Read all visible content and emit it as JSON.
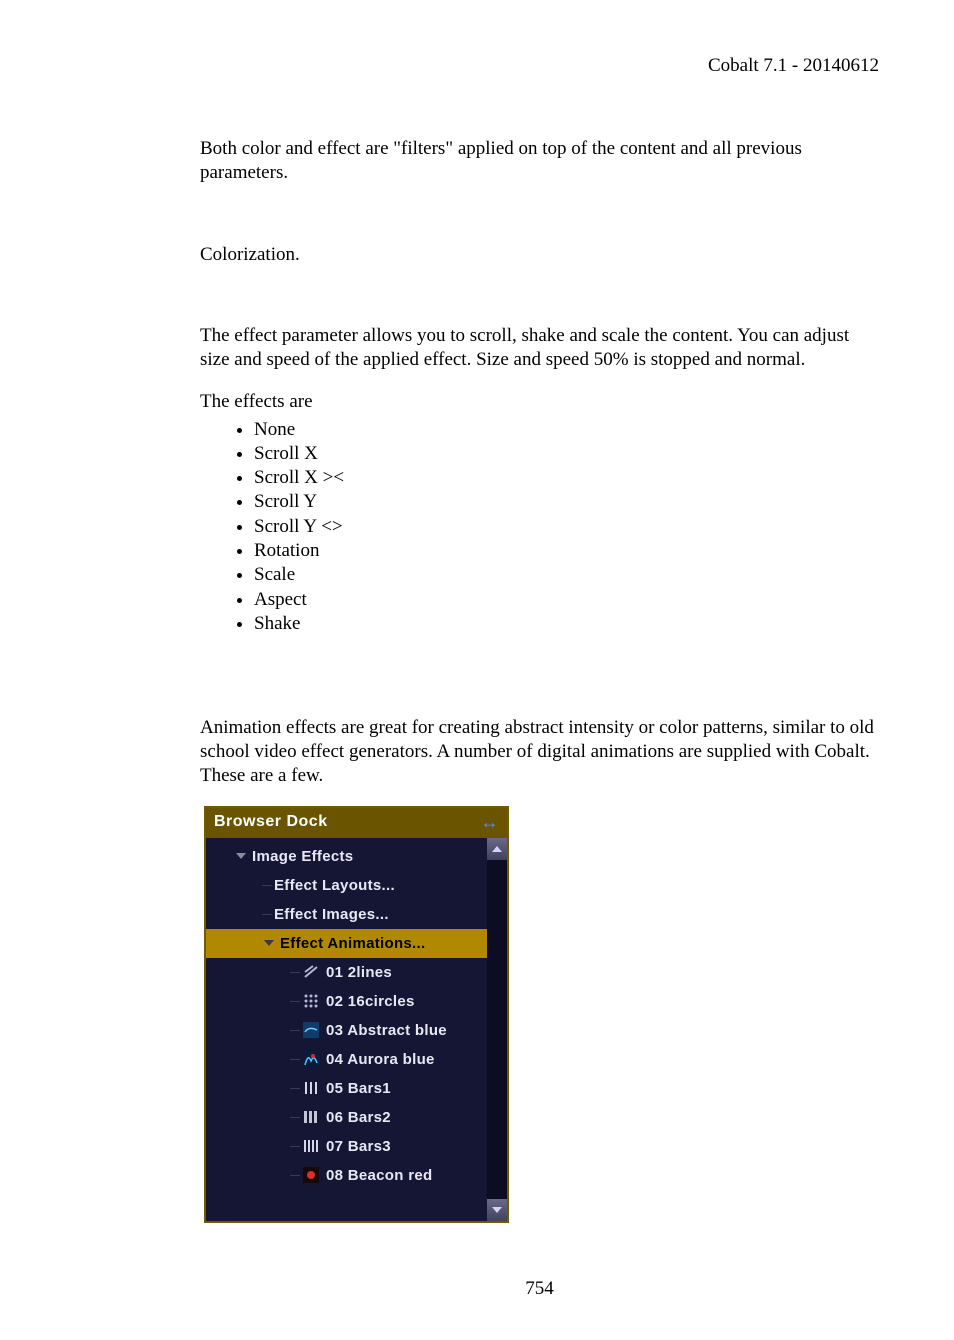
{
  "header": "Cobalt 7.1 - 20140612",
  "para1": "Both color and effect are \"filters\" applied on top of the content and all previous parameters.",
  "para2": "Colorization.",
  "para3": "The effect parameter allows you to scroll, shake and scale the content. You can adjust size and speed of the applied effect. Size and speed 50% is stopped and normal.",
  "para4": "The effects are",
  "effects_list": [
    "None",
    "Scroll X",
    "Scroll X ><",
    "Scroll Y",
    "Scroll Y <>",
    "Rotation",
    "Scale",
    "Aspect",
    "Shake"
  ],
  "para5": "Animation effects are great for creating abstract intensity or color patterns, similar to old school video effect generators. A number of digital animations are supplied with Cobalt. These are a few.",
  "dock": {
    "title": "Browser Dock",
    "tree": {
      "root": "Image Effects",
      "sub": [
        "Effect Layouts...",
        "Effect Images...",
        "Effect Animations..."
      ],
      "animations": [
        "01 2lines",
        "02 16circles",
        "03 Abstract blue",
        "04 Aurora blue",
        "05 Bars1",
        "06 Bars2",
        "07 Bars3",
        "08 Beacon red"
      ]
    }
  },
  "page_number": "754"
}
